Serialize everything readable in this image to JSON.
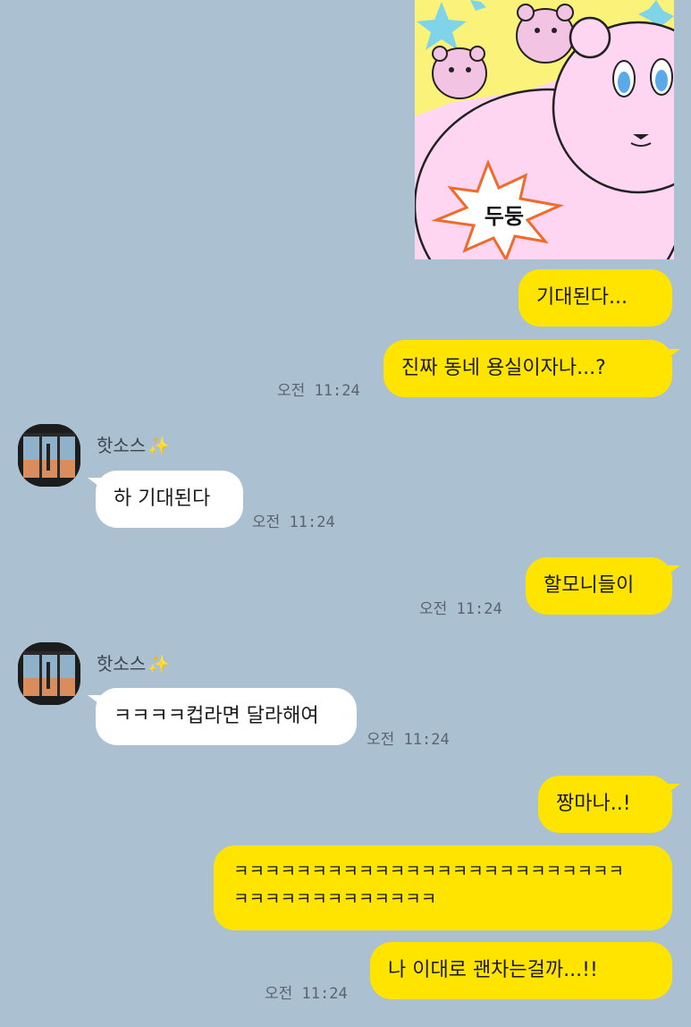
{
  "sticker": {
    "caption": "두둥",
    "icon": "bear-sticker-icon"
  },
  "messages": {
    "m1": {
      "text": "기대된다..."
    },
    "m2": {
      "text": "진짜 동네 용실이자나...?",
      "time": "오전 11:24"
    },
    "m3": {
      "sender": "핫소스",
      "text": "하 기대된다",
      "time": "오전 11:24"
    },
    "m4": {
      "text": "할모니들이",
      "time": "오전 11:24"
    },
    "m5": {
      "sender": "핫소스",
      "text": "ㅋㅋㅋㅋ컵라면 달라해여",
      "time": "오전 11:24"
    },
    "m6": {
      "text": "짱마나..!"
    },
    "m7": {
      "line1": "ㅋㅋㅋㅋㅋㅋㅋㅋㅋㅋㅋㅋㅋㅋㅋㅋㅋㅋㅋㅋㅋㅋㅋㅋㅋ",
      "line2": "ㅋㅋㅋㅋㅋㅋㅋㅋㅋㅋㅋㅋㅋ"
    },
    "m8": {
      "text": "나 이대로 괜차는걸까...!!",
      "time": "오전 11:24"
    }
  },
  "sender_icon": "sparkles-icon",
  "colors": {
    "background": "#abc0d1",
    "my_bubble": "#ffe400",
    "other_bubble": "#ffffff",
    "time_text": "#5a6470"
  }
}
